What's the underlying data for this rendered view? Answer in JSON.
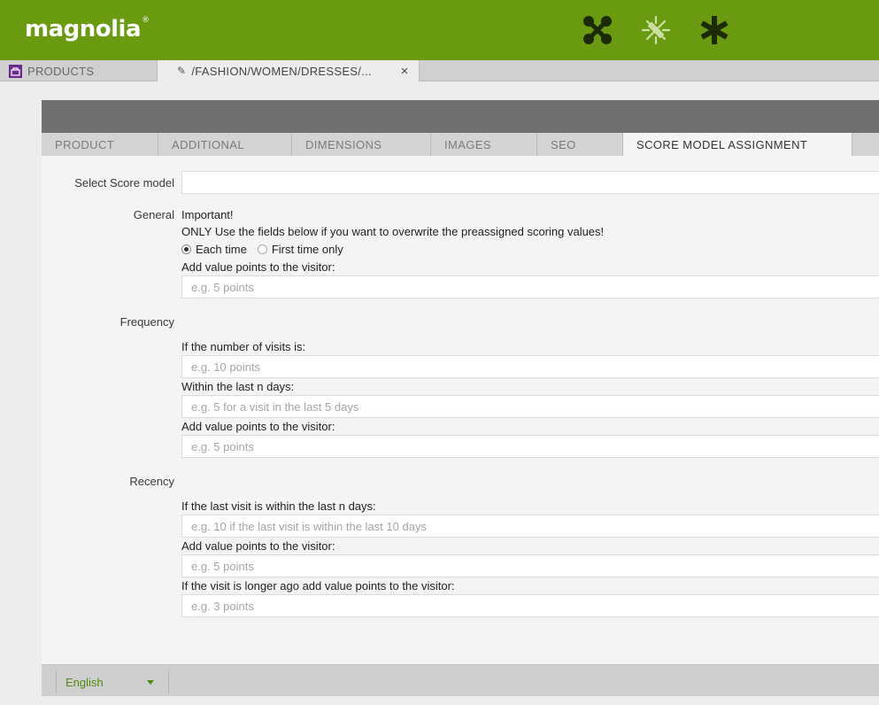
{
  "app": {
    "logo_text": "magnolia",
    "logo_mark": "®"
  },
  "tabs": {
    "products_label": "PRODUCTS",
    "path_label": "/FASHION/WOMEN/DRESSES/...",
    "close_glyph": "×"
  },
  "subtabs": [
    {
      "label": "PRODUCT"
    },
    {
      "label": "ADDITIONAL"
    },
    {
      "label": "DIMENSIONS"
    },
    {
      "label": "IMAGES"
    },
    {
      "label": "SEO"
    },
    {
      "label": "SCORE MODEL ASSIGNMENT"
    }
  ],
  "form": {
    "select_label": "Select Score model",
    "general_label": "General",
    "important": "Important!",
    "warning": "ONLY Use the fields below if you want to overwrite the preassigned scoring values!",
    "radio_each": "Each time",
    "radio_first": "First time only",
    "add_points_label": "Add value points to the visitor:",
    "add_points_ph": "e.g. 5 points",
    "frequency_label": "Frequency",
    "visits_label": "If the number of visits is:",
    "visits_ph": "e.g. 10 points",
    "within_label": "Within the last n days:",
    "within_ph": "e.g. 5 for a visit in the last 5 days",
    "freq_add_label": "Add value points to the visitor:",
    "freq_add_ph": "e.g. 5 points",
    "recency_label": "Recency",
    "last_visit_label": "If the last visit is within the last n days:",
    "last_visit_ph": "e.g. 10 if the last visit is within the last 10 days",
    "rec_add_label": "Add value points to the visitor:",
    "rec_add_ph": "e.g. 5 points",
    "longer_label": "If the visit is longer ago add value points to the visitor:",
    "longer_ph": "e.g. 3 points"
  },
  "footer": {
    "language": "English"
  },
  "colors": {
    "brand_green": "#6a9a0f",
    "accent_purple": "#6a2a8e",
    "link_green": "#4f8a0b"
  }
}
